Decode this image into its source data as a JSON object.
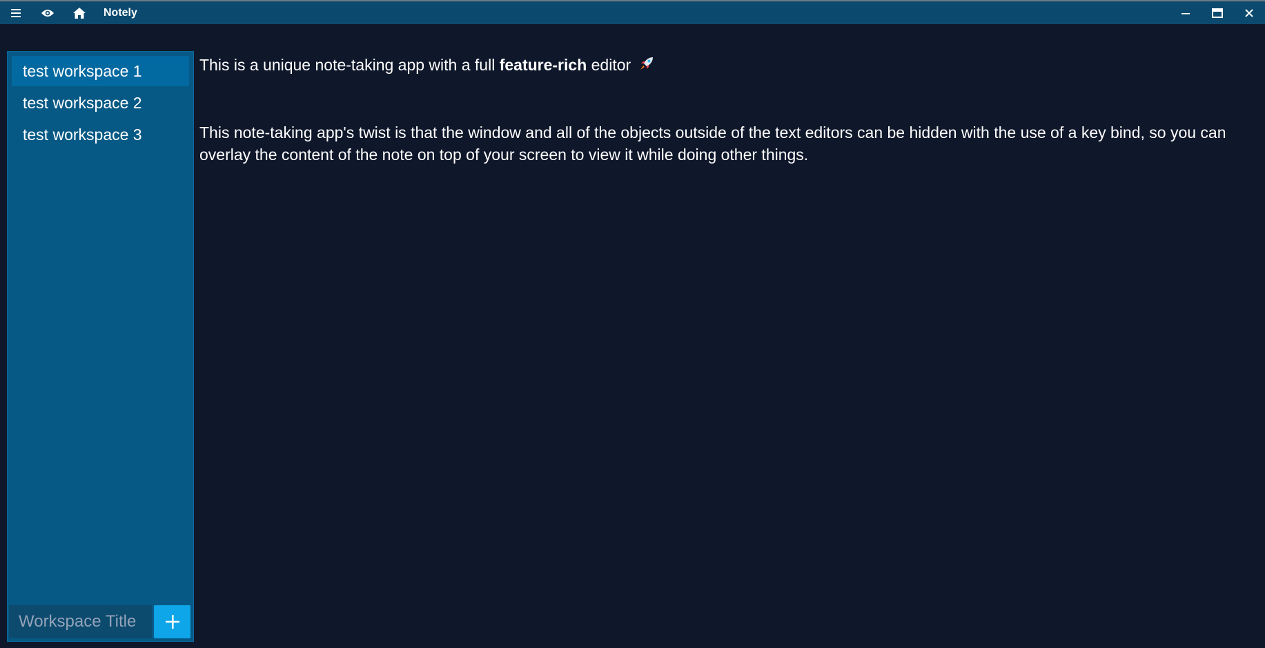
{
  "titlebar": {
    "app_title": "Notely",
    "left_icons": [
      "menu-icon",
      "eye-icon",
      "home-icon"
    ],
    "right_icons": [
      "minimize-icon",
      "maximize-icon",
      "close-icon"
    ]
  },
  "sidebar": {
    "items": [
      {
        "label": "test workspace 1",
        "active": true
      },
      {
        "label": "test workspace 2",
        "active": false
      },
      {
        "label": "test workspace 3",
        "active": false
      }
    ],
    "input": {
      "value": "",
      "placeholder": "Workspace Title"
    },
    "add_icon": "plus-icon"
  },
  "editor": {
    "p1_before": "This is a unique note-taking app with a full ",
    "p1_bold": "feature-rich",
    "p1_after": " editor",
    "p1_emoji": "rocket-icon",
    "p2": "This note-taking app's twist is that the window and all of the objects outside of the text editors can be hidden with the use of a key bind, so you can overlay the content of the note on top of your screen to view it while doing other things."
  },
  "colors": {
    "background": "#0f172a",
    "titlebar": "#0b4a6e",
    "sidebar": "#075985",
    "active_item": "#0369a1",
    "add_button": "#0ea5e9"
  }
}
